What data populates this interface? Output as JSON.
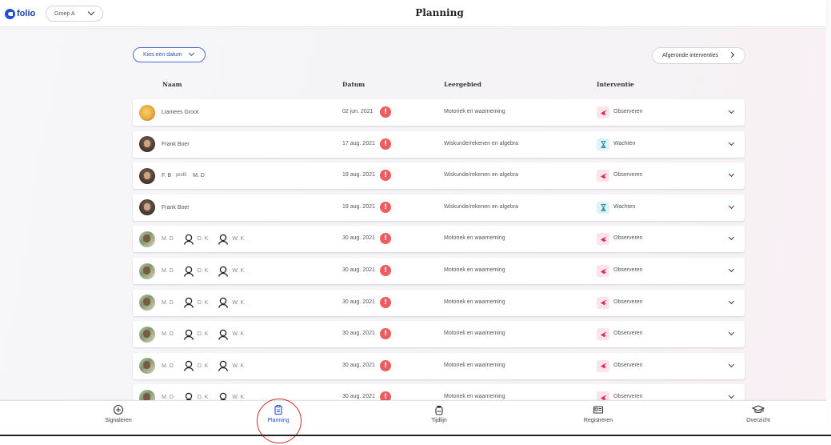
{
  "header": {
    "logo_text": "folio",
    "group_select": "Groep A",
    "title": "Planning"
  },
  "toolbar": {
    "date_picker_label": "Kies een datum",
    "completed_button_label": "Afgeronde interventies"
  },
  "table": {
    "columns": [
      "Naam",
      "Datum",
      "Leergebied",
      "Interventie"
    ],
    "rows": [
      {
        "names": [
          "Liamees Groot"
        ],
        "avatar": "yellow",
        "date": "02 jun. 2021",
        "area": "Motoriek en waarneming",
        "intervention": "Observeren",
        "intervention_icon": "megaphone-icon"
      },
      {
        "names": [
          "Frank Boer"
        ],
        "avatar": "man",
        "date": "17 aug. 2021",
        "area": "Wiskunde/rekenen en algebra",
        "intervention": "Wachten",
        "intervention_icon": "hourglass-icon"
      },
      {
        "names": [
          "F. B",
          "profil",
          "M. D"
        ],
        "avatar": "man",
        "date": "19 aug. 2021",
        "area": "Wiskunde/rekenen en algebra",
        "intervention": "Observeren",
        "intervention_icon": "megaphone-icon"
      },
      {
        "names": [
          "Frank Boer"
        ],
        "avatar": "man",
        "date": "19 aug. 2021",
        "area": "Wiskunde/rekenen en algebra",
        "intervention": "Wachten",
        "intervention_icon": "hourglass-icon"
      },
      {
        "names": [
          "M. D",
          "D. K",
          "W. K"
        ],
        "avatar": "photo",
        "date": "30 aug. 2021",
        "area": "Motoriek en waarneming",
        "intervention": "Observeren",
        "intervention_icon": "megaphone-icon"
      },
      {
        "names": [
          "M. D",
          "D. K",
          "W. K"
        ],
        "avatar": "photo",
        "date": "30 aug. 2021",
        "area": "Motoriek en waarneming",
        "intervention": "Observeren",
        "intervention_icon": "megaphone-icon"
      },
      {
        "names": [
          "M. D",
          "D. K",
          "W. K"
        ],
        "avatar": "photo",
        "date": "30 aug. 2021",
        "area": "Motoriek en waarneming",
        "intervention": "Observeren",
        "intervention_icon": "megaphone-icon"
      },
      {
        "names": [
          "M. D",
          "D. K",
          "W. K"
        ],
        "avatar": "photo",
        "date": "30 aug. 2021",
        "area": "Motoriek en waarneming",
        "intervention": "Observeren",
        "intervention_icon": "megaphone-icon"
      },
      {
        "names": [
          "M. D",
          "D. K",
          "W. K"
        ],
        "avatar": "photo",
        "date": "30 aug. 2021",
        "area": "Motoriek en waarneming",
        "intervention": "Observeren",
        "intervention_icon": "megaphone-icon"
      },
      {
        "names": [
          "M. D",
          "D. K",
          "W. K"
        ],
        "avatar": "photo",
        "date": "30 aug. 2021",
        "area": "Motoriek en waarneming",
        "intervention": "Observeren",
        "intervention_icon": "megaphone-icon"
      }
    ]
  },
  "bottom_nav": {
    "items": [
      {
        "label": "Signaleren",
        "icon": "plus-circle-icon",
        "active": false
      },
      {
        "label": "Planning",
        "icon": "clipboard-icon",
        "active": true
      },
      {
        "label": "Tijdlijn",
        "icon": "backpack-icon",
        "active": false
      },
      {
        "label": "Registreren",
        "icon": "id-card-icon",
        "active": false
      },
      {
        "label": "Overzicht",
        "icon": "graduation-cap-icon",
        "active": false
      }
    ]
  },
  "colors": {
    "brand": "#1d4fd8",
    "warning": "#ec5d5d",
    "observe": "#e0245e",
    "wait": "#1d8fa3"
  }
}
